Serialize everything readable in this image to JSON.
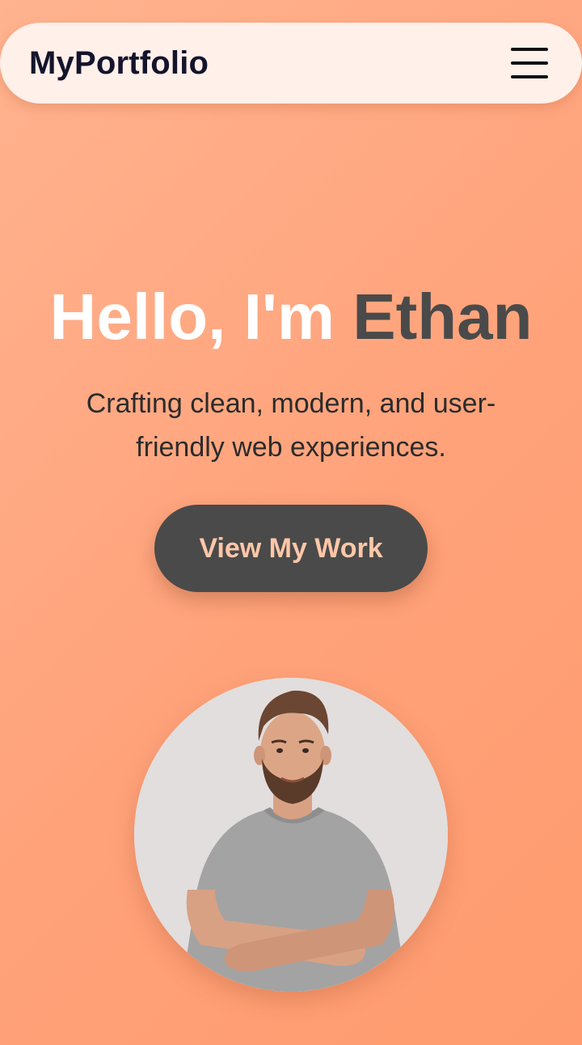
{
  "navbar": {
    "brand": "MyPortfolio",
    "menu_icon": "hamburger-menu-icon"
  },
  "hero": {
    "title_prefix": "Hello, I'm ",
    "title_name": "Ethan",
    "subtitle": "Crafting clean, modern, and user-friendly web experiences.",
    "cta_label": "View My Work"
  },
  "avatar": {
    "icon": "profile-photo"
  },
  "colors": {
    "background": "#ffa98a",
    "navbar_bg": "#fff0ea",
    "title_white": "#ffffff",
    "title_accent": "#4a4a4a",
    "button_bg": "#4a4a4a",
    "button_text": "#ffc7a8"
  }
}
